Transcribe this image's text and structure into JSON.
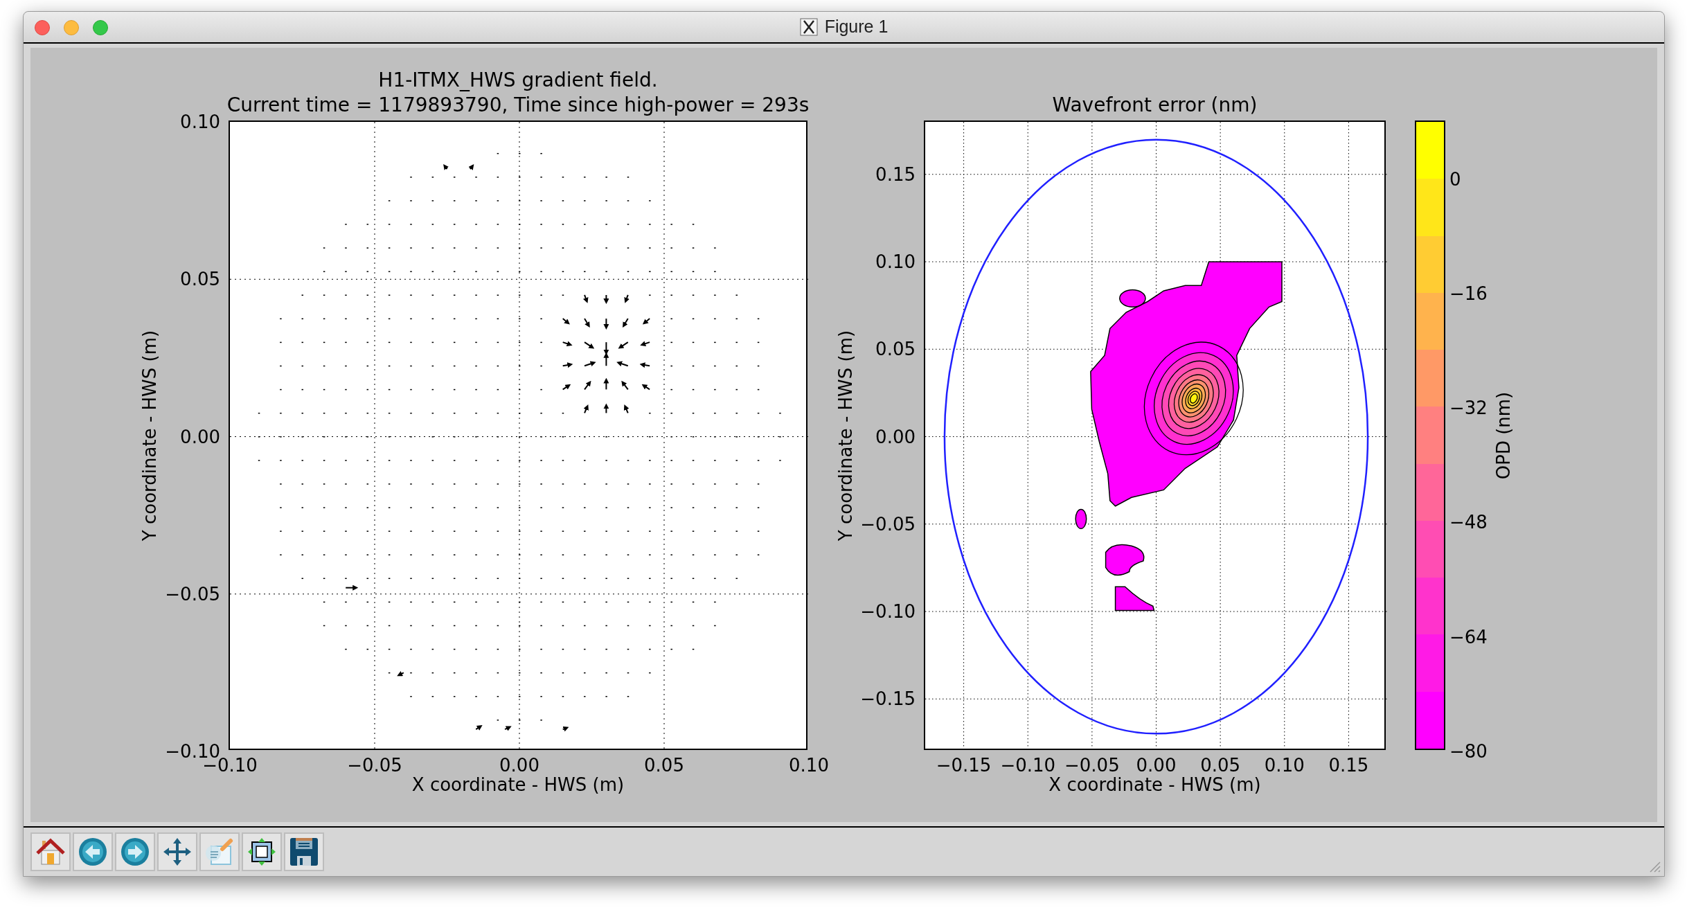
{
  "window": {
    "title": "Figure 1"
  },
  "gradient_plot": {
    "title_lines": [
      "H1-ITMX_HWS gradient field.",
      "Current time = 1179893790, Time since high-power = 293s"
    ],
    "xlabel": "X coordinate - HWS (m)",
    "ylabel": "Y coordinate - HWS (m)",
    "xticks": [
      "−0.10",
      "−0.05",
      "0.00",
      "0.05",
      "0.10"
    ],
    "yticks": [
      "0.10",
      "0.05",
      "0.00",
      "−0.05",
      "−0.10"
    ]
  },
  "wavefront_plot": {
    "title": "Wavefront error (nm)",
    "xlabel": "X coordinate - HWS (m)",
    "ylabel": "Y coordinate - HWS (m)",
    "xticks": [
      "−0.15",
      "−0.10",
      "−0.05",
      "0.00",
      "0.05",
      "0.10",
      "0.15"
    ],
    "yticks": [
      "0.15",
      "0.10",
      "0.05",
      "0.00",
      "−0.05",
      "−0.10",
      "−0.15"
    ]
  },
  "colorbar": {
    "label": "OPD (nm)",
    "ticks": [
      "0",
      "−16",
      "−32",
      "−48",
      "−64",
      "−80"
    ]
  },
  "toolbar": {
    "buttons": [
      {
        "kind": "home"
      },
      {
        "kind": "back"
      },
      {
        "kind": "forward"
      },
      {
        "kind": "pan"
      },
      {
        "kind": "edit"
      },
      {
        "kind": "subplots"
      },
      {
        "kind": "save"
      }
    ]
  }
}
